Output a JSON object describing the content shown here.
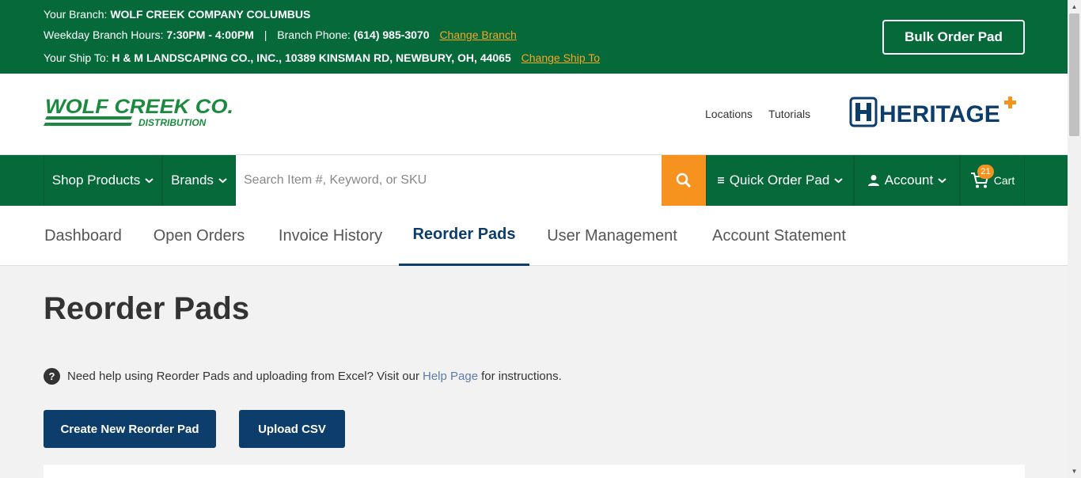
{
  "topbar": {
    "branch_prefix": "Your Branch:",
    "branch_name": "WOLF CREEK COMPANY COLUMBUS",
    "hours_prefix": "Weekday Branch Hours:",
    "hours_value": "7:30PM - 4:00PM",
    "separator": "|",
    "phone_prefix": "Branch Phone:",
    "phone_value": "(614) 985-3070",
    "change_branch": "Change Branch",
    "shipto_prefix": "Your Ship To:",
    "shipto_value": "H & M LANDSCAPING CO., INC., 10389 KINSMAN RD, NEWBURY, OH, 44065",
    "change_shipto": "Change Ship To",
    "bulk_order": "Bulk Order Pad"
  },
  "header": {
    "logo_main": "WOLF CREEK CO.",
    "logo_sub": "DISTRIBUTION",
    "links": [
      "Locations",
      "Tutorials"
    ],
    "partner_logo": "HERITAGE"
  },
  "nav": {
    "shop_products": "Shop Products",
    "brands": "Brands",
    "search_placeholder": "Search Item #, Keyword, or SKU",
    "quick_order": "Quick Order Pad",
    "account": "Account",
    "cart": "Cart",
    "cart_count": "21"
  },
  "tabs": [
    {
      "label": "Dashboard",
      "active": false
    },
    {
      "label": "Open Orders",
      "active": false
    },
    {
      "label": "Invoice History",
      "active": false
    },
    {
      "label": "Reorder Pads",
      "active": true
    },
    {
      "label": "User Management",
      "active": false
    },
    {
      "label": "Account Statement",
      "active": false
    }
  ],
  "main": {
    "title": "Reorder Pads",
    "help_icon": "?",
    "help_text_before": "Need help using Reorder Pads and uploading from Excel? Visit our",
    "help_link": "Help Page",
    "help_text_after": "for instructions.",
    "create_button": "Create New Reorder Pad",
    "upload_button": "Upload CSV"
  },
  "colors": {
    "brand_green": "#05693a",
    "accent_orange": "#f6921e",
    "navy": "#0d3d6b",
    "link_orange": "#f6a623"
  },
  "icons": {
    "search": "search-icon",
    "chevron": "chevron-down-icon",
    "user": "user-icon",
    "cart": "cart-icon",
    "list": "list-icon",
    "help": "help-icon"
  }
}
